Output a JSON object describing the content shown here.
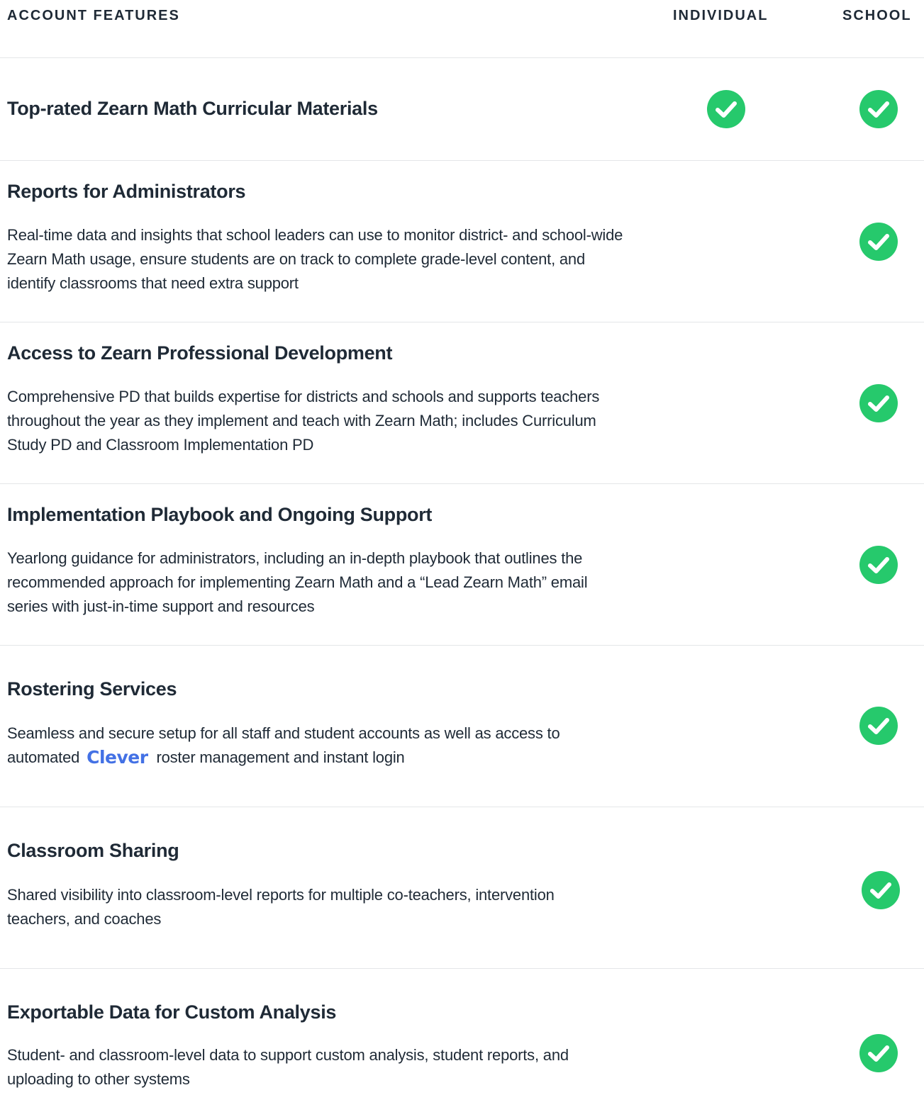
{
  "header": {
    "features_label": "ACCOUNT FEATURES",
    "individual_label": "INDIVIDUAL",
    "school_label": "SCHOOL"
  },
  "rows": [
    {
      "title": "Top-rated Zearn Math Curricular Materials",
      "description": "",
      "individual": true,
      "school": true
    },
    {
      "title": "Reports for Administrators",
      "description": "Real-time data and insights that school leaders can use to monitor district- and school-wide Zearn Math usage, ensure students are on track to complete grade-level content, and identify classrooms that need extra support",
      "individual": false,
      "school": true
    },
    {
      "title": "Access to Zearn Professional Development",
      "description": "Comprehensive PD that builds expertise for districts and schools and supports teachers throughout the year as they implement and teach with Zearn Math; includes Curriculum Study PD and Classroom Implementation PD",
      "individual": false,
      "school": true
    },
    {
      "title": "Implementation Playbook and Ongoing Support",
      "description": "Yearlong guidance for administrators, including an in-depth playbook that outlines the recommended approach for implementing Zearn Math and a “Lead Zearn Math” email series with just-in-time support and resources",
      "individual": false,
      "school": true
    },
    {
      "title": "Rostering Services",
      "description_before": "Seamless and secure setup for all staff and student accounts as well as access to automated",
      "logo_text": "Clever",
      "description_after": "roster management and instant login",
      "individual": false,
      "school": true
    },
    {
      "title": "Classroom Sharing",
      "description": "Shared visibility into classroom-level reports for multiple co-teachers, intervention teachers, and coaches",
      "individual": false,
      "school": true
    },
    {
      "title": "Exportable Data for Custom Analysis",
      "description": "Student- and classroom-level data to support custom analysis, student reports, and uploading to other systems",
      "individual": false,
      "school": true
    }
  ],
  "colors": {
    "check": "#26c96c",
    "text": "#1f2a36",
    "divider": "#e4e6e8",
    "clever": "#4371e5"
  },
  "icons": {
    "check": "check-circle-icon"
  }
}
